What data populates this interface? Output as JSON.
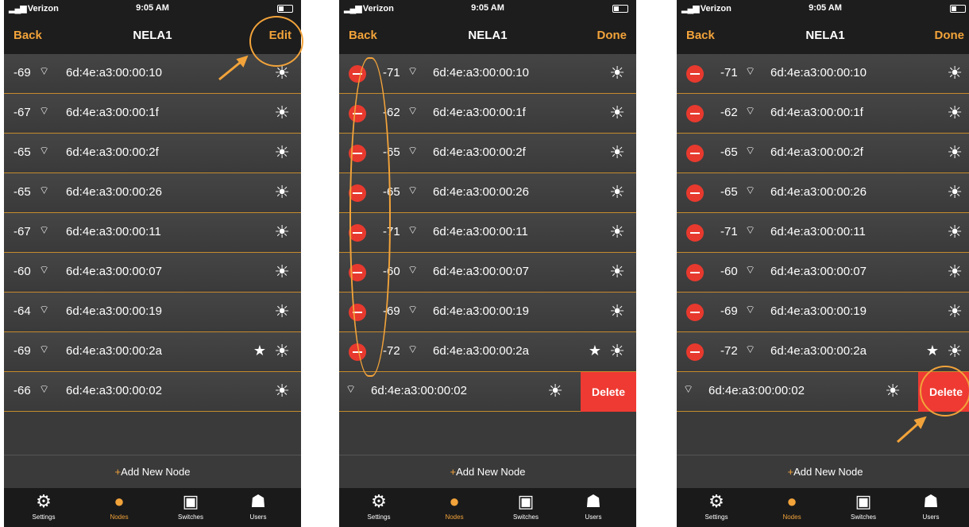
{
  "status": {
    "carrier": "Verizon",
    "time": "9:05 AM"
  },
  "screens": [
    {
      "nav": {
        "left": "Back",
        "title": "NELA1",
        "right": "Edit"
      },
      "rows": [
        {
          "rssi": "-69",
          "mac": "6d:4e:a3:00:00:10"
        },
        {
          "rssi": "-67",
          "mac": "6d:4e:a3:00:00:1f"
        },
        {
          "rssi": "-65",
          "mac": "6d:4e:a3:00:00:2f"
        },
        {
          "rssi": "-65",
          "mac": "6d:4e:a3:00:00:26"
        },
        {
          "rssi": "-67",
          "mac": "6d:4e:a3:00:00:11"
        },
        {
          "rssi": "-60",
          "mac": "6d:4e:a3:00:00:07"
        },
        {
          "rssi": "-64",
          "mac": "6d:4e:a3:00:00:19"
        },
        {
          "rssi": "-69",
          "mac": "6d:4e:a3:00:00:2a",
          "star": true
        },
        {
          "rssi": "-66",
          "mac": "6d:4e:a3:00:00:02"
        }
      ]
    },
    {
      "nav": {
        "left": "Back",
        "title": "NELA1",
        "right": "Done"
      },
      "rows": [
        {
          "rssi": "-71",
          "mac": "6d:4e:a3:00:00:10"
        },
        {
          "rssi": "-62",
          "mac": "6d:4e:a3:00:00:1f"
        },
        {
          "rssi": "-65",
          "mac": "6d:4e:a3:00:00:2f"
        },
        {
          "rssi": "-65",
          "mac": "6d:4e:a3:00:00:26"
        },
        {
          "rssi": "-71",
          "mac": "6d:4e:a3:00:00:11"
        },
        {
          "rssi": "-60",
          "mac": "6d:4e:a3:00:00:07"
        },
        {
          "rssi": "-69",
          "mac": "6d:4e:a3:00:00:19"
        },
        {
          "rssi": "-72",
          "mac": "6d:4e:a3:00:00:2a",
          "star": true
        },
        {
          "mac": "6d:4e:a3:00:00:02",
          "swiped": true
        }
      ]
    },
    {
      "nav": {
        "left": "Back",
        "title": "NELA1",
        "right": "Done"
      },
      "rows": [
        {
          "rssi": "-71",
          "mac": "6d:4e:a3:00:00:10"
        },
        {
          "rssi": "-62",
          "mac": "6d:4e:a3:00:00:1f"
        },
        {
          "rssi": "-65",
          "mac": "6d:4e:a3:00:00:2f"
        },
        {
          "rssi": "-65",
          "mac": "6d:4e:a3:00:00:26"
        },
        {
          "rssi": "-71",
          "mac": "6d:4e:a3:00:00:11"
        },
        {
          "rssi": "-60",
          "mac": "6d:4e:a3:00:00:07"
        },
        {
          "rssi": "-69",
          "mac": "6d:4e:a3:00:00:19"
        },
        {
          "rssi": "-72",
          "mac": "6d:4e:a3:00:00:2a",
          "star": true
        },
        {
          "mac": "6d:4e:a3:00:00:02",
          "swiped": true
        }
      ]
    }
  ],
  "delete_label": "Delete",
  "add_node": "Add New Node",
  "tabs": [
    {
      "label": "Settings",
      "icon": "gear-icon"
    },
    {
      "label": "Nodes",
      "icon": "bulb-icon",
      "active": true
    },
    {
      "label": "Switches",
      "icon": "switch-icon"
    },
    {
      "label": "Users",
      "icon": "user-icon"
    }
  ],
  "colors": {
    "accent": "#f2a33a",
    "delete": "#ee3a32",
    "background": "#3a3a3a",
    "bar": "#1d1d1d"
  }
}
